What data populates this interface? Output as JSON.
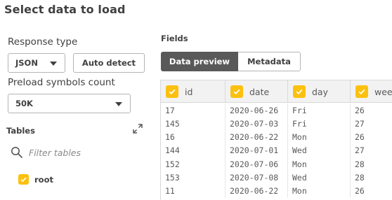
{
  "dialog": {
    "title": "Select data to load"
  },
  "left": {
    "response_type_label": "Response type",
    "response_type_value": "JSON",
    "auto_detect_label": "Auto detect",
    "preload_label": "Preload symbols count",
    "preload_value": "50K",
    "tables_label": "Tables",
    "filter_placeholder": "Filter tables",
    "tables": [
      {
        "name": "root",
        "checked": true
      }
    ]
  },
  "fields": {
    "label": "Fields",
    "tabs": [
      {
        "label": "Data preview",
        "active": true
      },
      {
        "label": "Metadata",
        "active": false
      }
    ]
  },
  "grid": {
    "columns": [
      "id",
      "date",
      "day",
      "week"
    ],
    "rows": [
      [
        "17",
        "2020-06-26",
        "Fri",
        "26"
      ],
      [
        "145",
        "2020-07-03",
        "Fri",
        "27"
      ],
      [
        "16",
        "2020-06-22",
        "Mon",
        "26"
      ],
      [
        "144",
        "2020-07-01",
        "Wed",
        "27"
      ],
      [
        "152",
        "2020-07-06",
        "Mon",
        "28"
      ],
      [
        "153",
        "2020-07-08",
        "Wed",
        "28"
      ],
      [
        "11",
        "2020-06-22",
        "Mon",
        "26"
      ]
    ]
  },
  "colors": {
    "accent": "#fcc00f",
    "active_tab": "#595959",
    "text": "#404040"
  }
}
